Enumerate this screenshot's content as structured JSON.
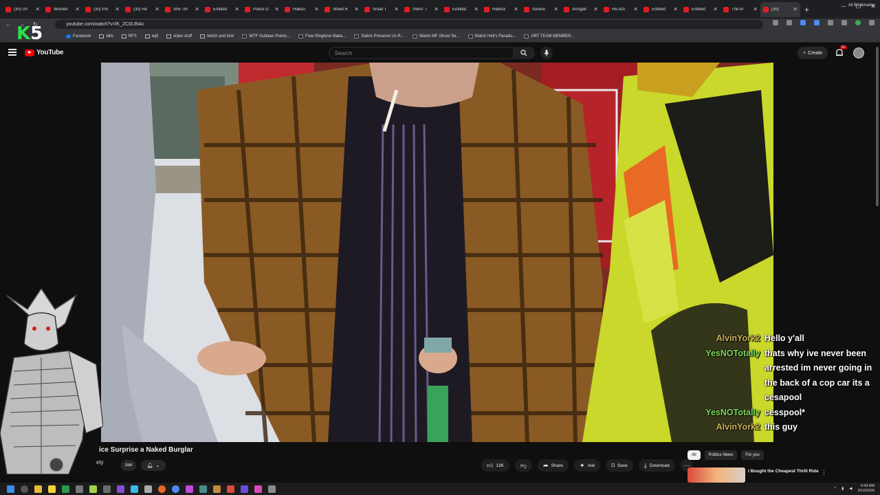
{
  "browser": {
    "tabs": [
      {
        "label": "(30) Un"
      },
      {
        "label": "Women"
      },
      {
        "label": "(30) Pol"
      },
      {
        "label": "(30) He"
      },
      {
        "label": "She Thr"
      },
      {
        "label": "Entitled"
      },
      {
        "label": "Police O"
      },
      {
        "label": "Halluci"
      },
      {
        "label": "Street R"
      },
      {
        "label": "Small T"
      },
      {
        "label": "SWAT T"
      },
      {
        "label": "Entitled"
      },
      {
        "label": "Hateful"
      },
      {
        "label": "Sovere"
      },
      {
        "label": "Arrogan"
      },
      {
        "label": "He Acti"
      },
      {
        "label": "Entitled"
      },
      {
        "label": "Entitled"
      },
      {
        "label": "The M"
      },
      {
        "label": "(30)"
      }
    ],
    "url": "youtube.com/watch?v=lK_ZC0LBtAc",
    "bookmarks": [
      {
        "label": "Facebook",
        "icon": "facebook-icon"
      },
      {
        "label": "bills",
        "icon": "folder-icon"
      },
      {
        "label": "RFS",
        "icon": "folder-icon"
      },
      {
        "label": "eqll",
        "icon": "folder-icon"
      },
      {
        "label": "video stuff",
        "icon": "folder-icon"
      },
      {
        "label": "twitch and kick",
        "icon": "folder-icon"
      },
      {
        "label": "WTF Outlaws Points...",
        "icon": "site-icon"
      },
      {
        "label": "Free Ringtone Make...",
        "icon": "site-icon"
      },
      {
        "label": "Saints Preserve Us R...",
        "icon": "site-icon"
      },
      {
        "label": "Watch MF Ghost Se...",
        "icon": "site-icon"
      },
      {
        "label": "Watch Hell's Paradis...",
        "icon": "site-icon"
      },
      {
        "label": "ART TEAM MEMBER...",
        "icon": "site-icon"
      }
    ],
    "all_bookmarks": "All Bookmarks"
  },
  "youtube": {
    "logo_text": "YouTube",
    "search_placeholder": "Search",
    "create_label": "Create",
    "notification_count": "9+"
  },
  "overlay": {
    "k5_k": "K",
    "k5_num": "5"
  },
  "chat": [
    {
      "name": "AlvinYork2",
      "message": "Hello y'all",
      "color": "#c9b25a"
    },
    {
      "name": "YesNOTotally",
      "message": "thats why ive never been arrested im never going in the back of a cop car its a cesapool",
      "color": "#7cd65a"
    },
    {
      "name": "YesNOTotally",
      "message": "cesspool*",
      "color": "#7cd65a"
    },
    {
      "name": "AlvinYork2",
      "message": "this guy",
      "color": "#c9b25a"
    }
  ],
  "video_info": {
    "title": "ice Surprise a Naked Burglar",
    "channel_fragment": "ety",
    "join_label": "Join",
    "like_count": "13K",
    "share_label": "Share",
    "ask_label": "Ask",
    "save_label": "Save",
    "download_label": "Download"
  },
  "sidebar": {
    "chips": [
      "All",
      "Politics News",
      "For you"
    ],
    "recommended": {
      "title": "I Bought the Cheapest Thrill Ride"
    }
  },
  "taskbar": {
    "time": "6:43 AM",
    "date": "3/10/2026"
  },
  "colors": {
    "yt_red": "#ff0000",
    "chat_alvin": "#c9b25a",
    "chat_yes": "#7cd65a",
    "k5_green": "#2ee04a"
  }
}
